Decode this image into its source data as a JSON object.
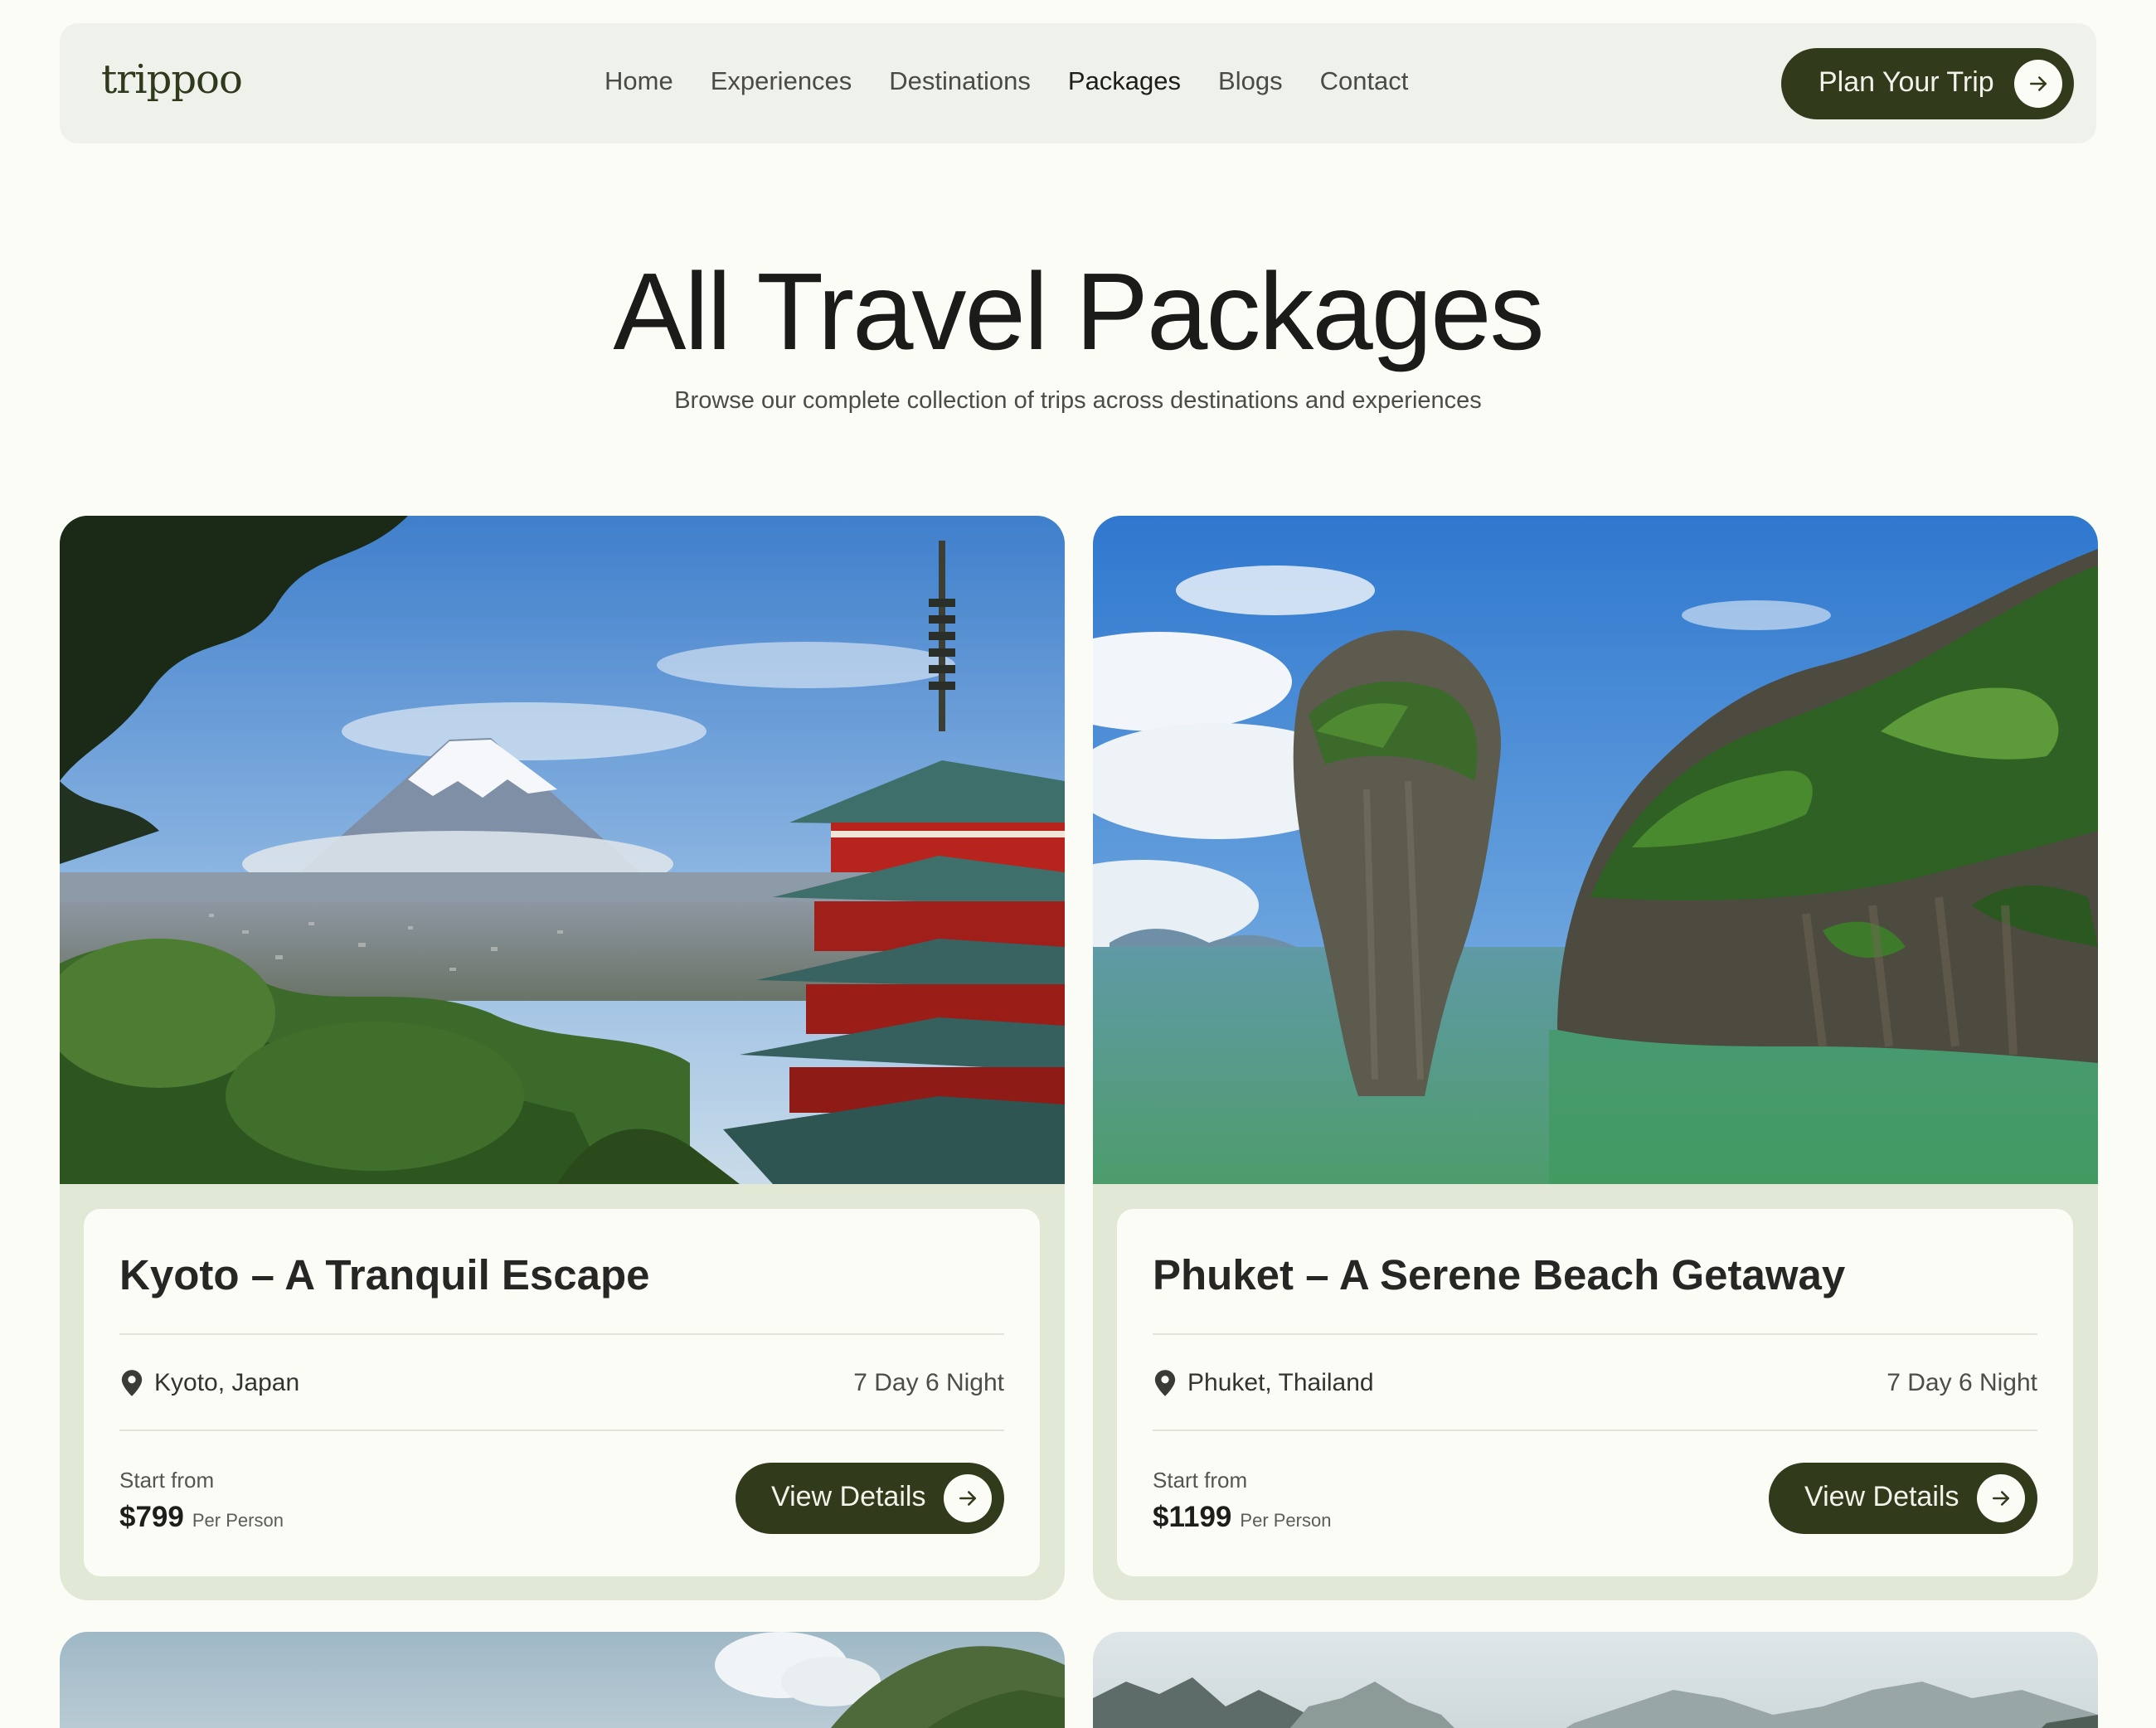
{
  "navbar": {
    "logo": "trippoo",
    "links": [
      "Home",
      "Experiences",
      "Destinations",
      "Packages",
      "Blogs",
      "Contact"
    ],
    "active_link": "Packages",
    "cta_label": "Plan Your Trip"
  },
  "hero": {
    "title": "All Travel Packages",
    "subtitle": "Browse our complete collection of trips across destinations and experiences"
  },
  "packages": [
    {
      "title": "Kyoto – A Tranquil Escape",
      "location": "Kyoto, Japan",
      "duration": "7 Day 6 Night",
      "start_label": "Start from",
      "price": "$799",
      "price_unit": "Per Person",
      "button_label": "View Details"
    },
    {
      "title": "Phuket – A Serene Beach Getaway",
      "location": "Phuket, Thailand",
      "duration": "7 Day 6 Night",
      "start_label": "Start from",
      "price": "$1199",
      "price_unit": "Per Person",
      "button_label": "View Details"
    }
  ],
  "colors": {
    "page_bg": "#fcfcf7",
    "nav_bg": "#eff1eb",
    "brand_dark_green": "#313b1c",
    "card_frame": "#e1e8d5"
  },
  "icons": {
    "cta_arrow": "arrow-right-icon",
    "location": "map-pin-icon"
  }
}
